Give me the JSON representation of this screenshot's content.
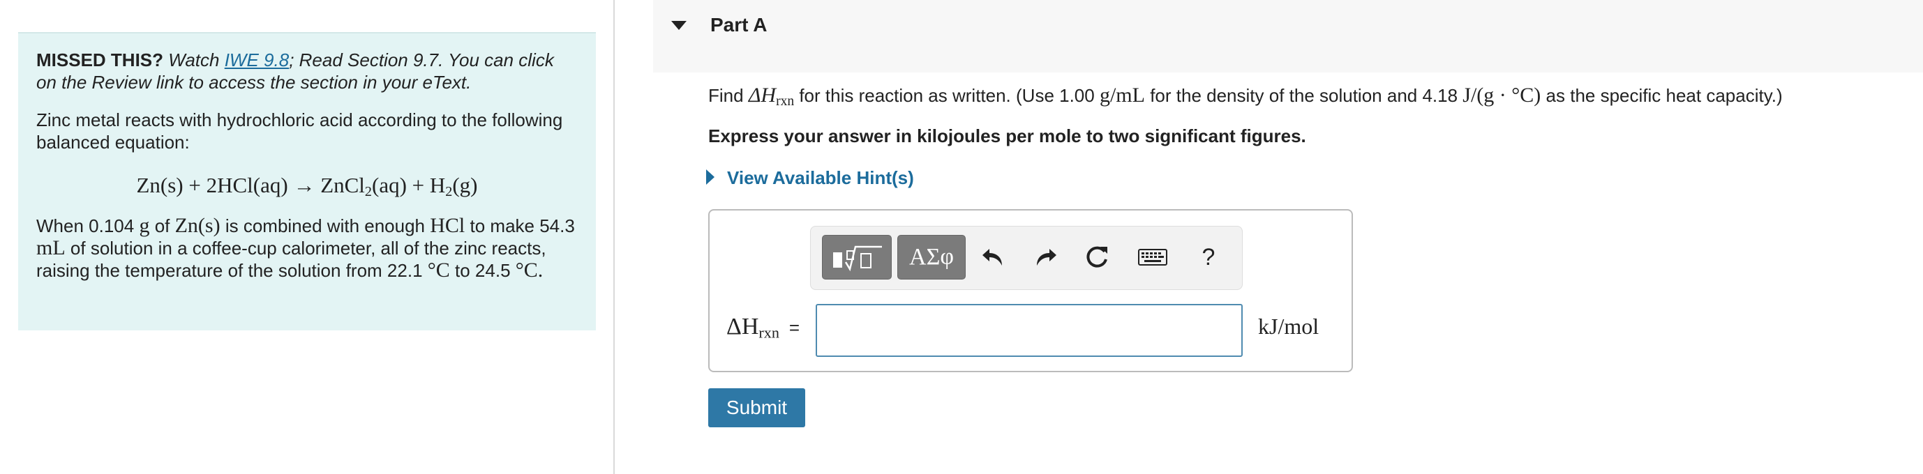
{
  "missed": {
    "label": "MISSED THIS?",
    "watch_prefix": "Watch",
    "link_text": "IWE 9.8",
    "rest": "; Read Section 9.7. You can click on the Review link to access the section in your eText."
  },
  "problem": {
    "intro": "Zinc metal reacts with hydrochloric acid according to the following balanced equation:",
    "equation": {
      "part1": "Zn(s) + 2HCl(aq) → ZnCl",
      "sub1": "2",
      "part2": "(aq) + H",
      "sub2": "2",
      "part3": "(g)"
    },
    "details": {
      "t1": "When 0.104",
      "m1": "g",
      "t2": "of",
      "m2": "Zn(s)",
      "t3": "is combined with enough",
      "m3": "HCl",
      "t4": "to make 54.3",
      "m4": "mL",
      "t5": "of solution in a coffee-cup calorimeter, all of the zinc reacts, raising the temperature of the solution from 22.1",
      "m5": "°C",
      "t6": "to 24.5",
      "m6": "°C."
    }
  },
  "part": {
    "title": "Part A"
  },
  "question": {
    "find": "Find",
    "dh": "ΔH",
    "dh_sub": "rxn",
    "t1": "for this reaction as written. (Use 1.00",
    "m1": "g/mL",
    "t2": "for the density of the solution and 4.18",
    "m2": "J/(g · °C)",
    "t3": "as the specific heat capacity.)",
    "express": "Express your answer in kilojoules per mole to two significant figures."
  },
  "hint": {
    "label": "View Available Hint(s)"
  },
  "toolbar": {
    "symbols_label": "ΑΣφ",
    "help_label": "?"
  },
  "answer": {
    "label": "ΔH",
    "label_sub": "rxn",
    "equals": "=",
    "value": "",
    "unit": "kJ/mol"
  },
  "submit": {
    "label": "Submit"
  },
  "colors": {
    "link": "#1c6c9c",
    "info_bg": "#e3f4f4",
    "submit_bg": "#2e78a6",
    "input_border": "#4f8bb0"
  }
}
